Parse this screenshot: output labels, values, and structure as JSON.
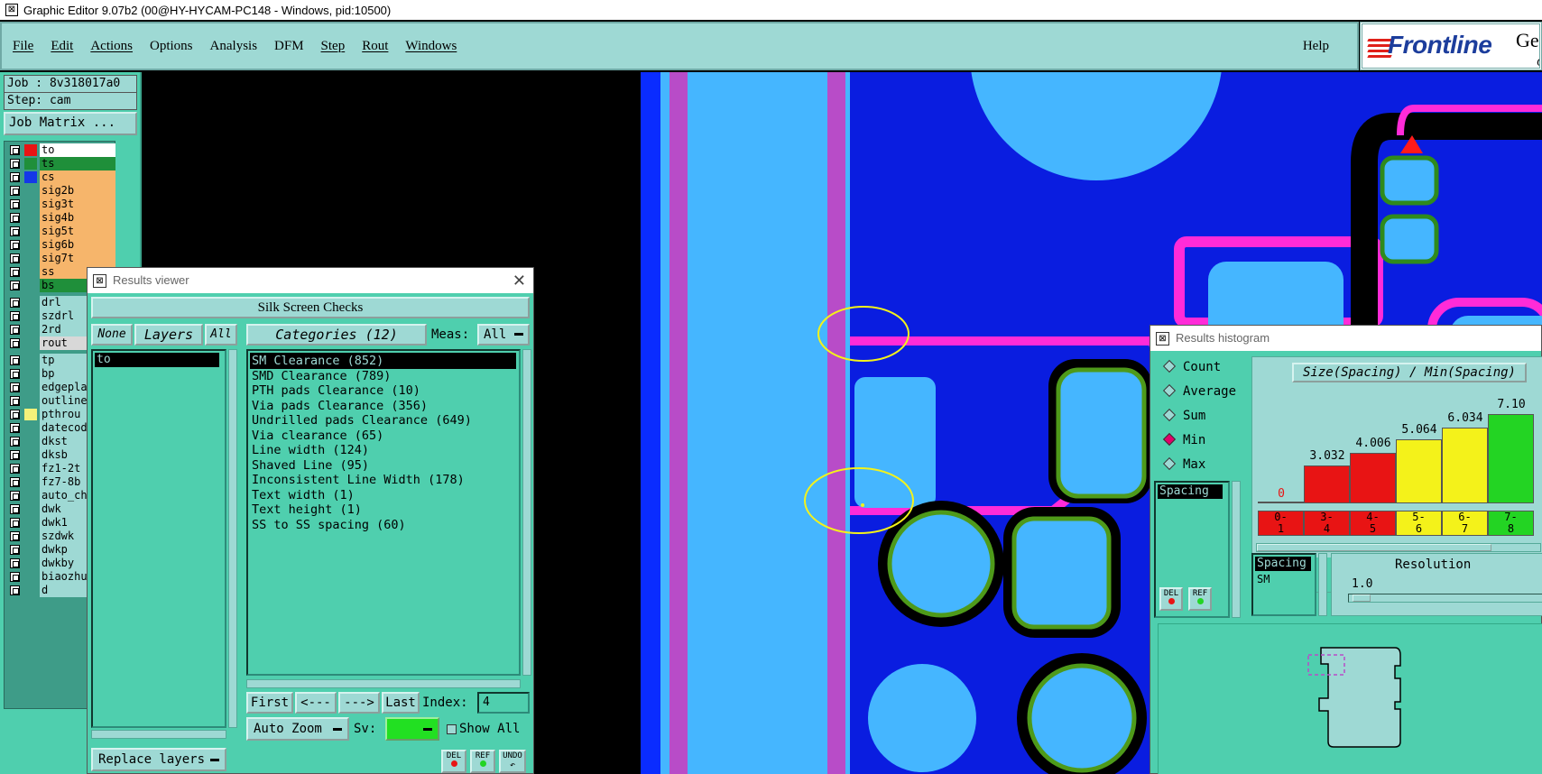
{
  "window": {
    "title": "Graphic Editor 9.07b2 (00@HY-HYCAM-PC148 - Windows, pid:10500)"
  },
  "menu": {
    "items": [
      "File",
      "Edit",
      "Actions",
      "Options",
      "Analysis",
      "DFM",
      "Step",
      "Rout",
      "Windows"
    ],
    "help": "Help"
  },
  "logo": {
    "brand": "Frontline",
    "tail": "Ger",
    "tail2": "G"
  },
  "job": {
    "job": "Job : 8v318017a0",
    "step": "Step: cam",
    "matrix_button": "Job Matrix ..."
  },
  "layers": [
    {
      "name": "to",
      "color": "#ffffff",
      "swatch": "#e81414"
    },
    {
      "name": "ts",
      "color": "#1f8f3a",
      "swatch": "#1f8f3a"
    },
    {
      "name": "cs",
      "color": "#f6b56b",
      "swatch": "#1438e8"
    },
    {
      "name": "sig2b",
      "color": "#f6b56b",
      "swatch": ""
    },
    {
      "name": "sig3t",
      "color": "#f6b56b",
      "swatch": ""
    },
    {
      "name": "sig4b",
      "color": "#f6b56b",
      "swatch": ""
    },
    {
      "name": "sig5t",
      "color": "#f6b56b",
      "swatch": ""
    },
    {
      "name": "sig6b",
      "color": "#f6b56b",
      "swatch": ""
    },
    {
      "name": "sig7t",
      "color": "#f6b56b",
      "swatch": ""
    },
    {
      "name": "ss",
      "color": "#f6b56b",
      "swatch": ""
    },
    {
      "name": "bs",
      "color": "#1f8f3a",
      "swatch": ""
    },
    {
      "name": "drl",
      "color": "#9ed9d4",
      "swatch": ""
    },
    {
      "name": "szdrl",
      "color": "#9ed9d4",
      "swatch": ""
    },
    {
      "name": "2rd",
      "color": "#9ed9d4",
      "swatch": ""
    },
    {
      "name": "rout",
      "color": "#d8d8d8",
      "swatch": ""
    },
    {
      "name": "tp",
      "color": "#9ed9d4",
      "swatch": ""
    },
    {
      "name": "bp",
      "color": "#9ed9d4",
      "swatch": ""
    },
    {
      "name": "edgeplat",
      "color": "#9ed9d4",
      "swatch": ""
    },
    {
      "name": "outline",
      "color": "#9ed9d4",
      "swatch": ""
    },
    {
      "name": "pthrou",
      "color": "#9ed9d4",
      "swatch": "#f4f27a"
    },
    {
      "name": "datecode",
      "color": "#9ed9d4",
      "swatch": ""
    },
    {
      "name": "dkst",
      "color": "#9ed9d4",
      "swatch": ""
    },
    {
      "name": "dksb",
      "color": "#9ed9d4",
      "swatch": ""
    },
    {
      "name": "fz1-2t",
      "color": "#9ed9d4",
      "swatch": ""
    },
    {
      "name": "fz7-8b",
      "color": "#9ed9d4",
      "swatch": ""
    },
    {
      "name": "auto_chk",
      "color": "#9ed9d4",
      "swatch": ""
    },
    {
      "name": "dwk",
      "color": "#9ed9d4",
      "swatch": ""
    },
    {
      "name": "dwk1",
      "color": "#9ed9d4",
      "swatch": ""
    },
    {
      "name": "szdwk",
      "color": "#9ed9d4",
      "swatch": ""
    },
    {
      "name": "dwkp",
      "color": "#9ed9d4",
      "swatch": ""
    },
    {
      "name": "dwkby",
      "color": "#9ed9d4",
      "swatch": ""
    },
    {
      "name": "biaozhu",
      "color": "#9ed9d4",
      "swatch": ""
    },
    {
      "name": "d",
      "color": "#9ed9d4",
      "swatch": ""
    }
  ],
  "results_viewer": {
    "title": "Results viewer",
    "banner": "Silk Screen Checks",
    "none_btn": "None",
    "layers_btn": "Layers",
    "all_btn": "All",
    "categories_btn": "Categories (12)",
    "meas_label": "Meas:",
    "meas_value": "All",
    "layer_items": [
      "to"
    ],
    "categories": [
      "SM Clearance (852)",
      "SMD Clearance (789)",
      "PTH pads Clearance (10)",
      "Via pads Clearance (356)",
      "Undrilled pads Clearance (649)",
      "Via clearance (65)",
      "Line width (124)",
      "Shaved Line (95)",
      "Inconsistent Line Width (178)",
      "Text width (1)",
      "Text height (1)",
      "SS to SS spacing (60)"
    ],
    "first_btn": "First",
    "prev_btn": "<---",
    "next_btn": "--->",
    "last_btn": "Last",
    "index_label": "Index:",
    "index_value": "4",
    "autozoom": "Auto Zoom",
    "sv_label": "Sv:",
    "show_all": "Show All",
    "replace_layers": "Replace layers",
    "del": "DEL",
    "ref": "REF",
    "undo": "UNDO"
  },
  "histogram": {
    "title": "Results histogram",
    "heading": "Size(Spacing) / Min(Spacing)",
    "modes": [
      "Count",
      "Average",
      "Sum",
      "Min",
      "Max"
    ],
    "selected_mode": "Min",
    "list_items": [
      "Spacing"
    ],
    "list2_items": [
      "Spacing",
      "SM"
    ],
    "resolution_label": "Resolution",
    "resolution_value": "1.0",
    "del": "DEL",
    "ref": "REF",
    "bars": [
      {
        "label": "0",
        "value": 0,
        "color": "#e81414",
        "bin": "0-\n1"
      },
      {
        "label": "3.032",
        "value": 3.032,
        "color": "#e81414",
        "bin": "3-\n4"
      },
      {
        "label": "4.006",
        "value": 4.006,
        "color": "#e81414",
        "bin": "4-\n5"
      },
      {
        "label": "5.064",
        "value": 5.064,
        "color": "#f4f21a",
        "bin": "5-\n6"
      },
      {
        "label": "6.034",
        "value": 6.034,
        "color": "#f4f21a",
        "bin": "6-\n7"
      },
      {
        "label": "7.10",
        "value": 7.1,
        "color": "#23d423",
        "bin": "7-\n8"
      }
    ]
  }
}
